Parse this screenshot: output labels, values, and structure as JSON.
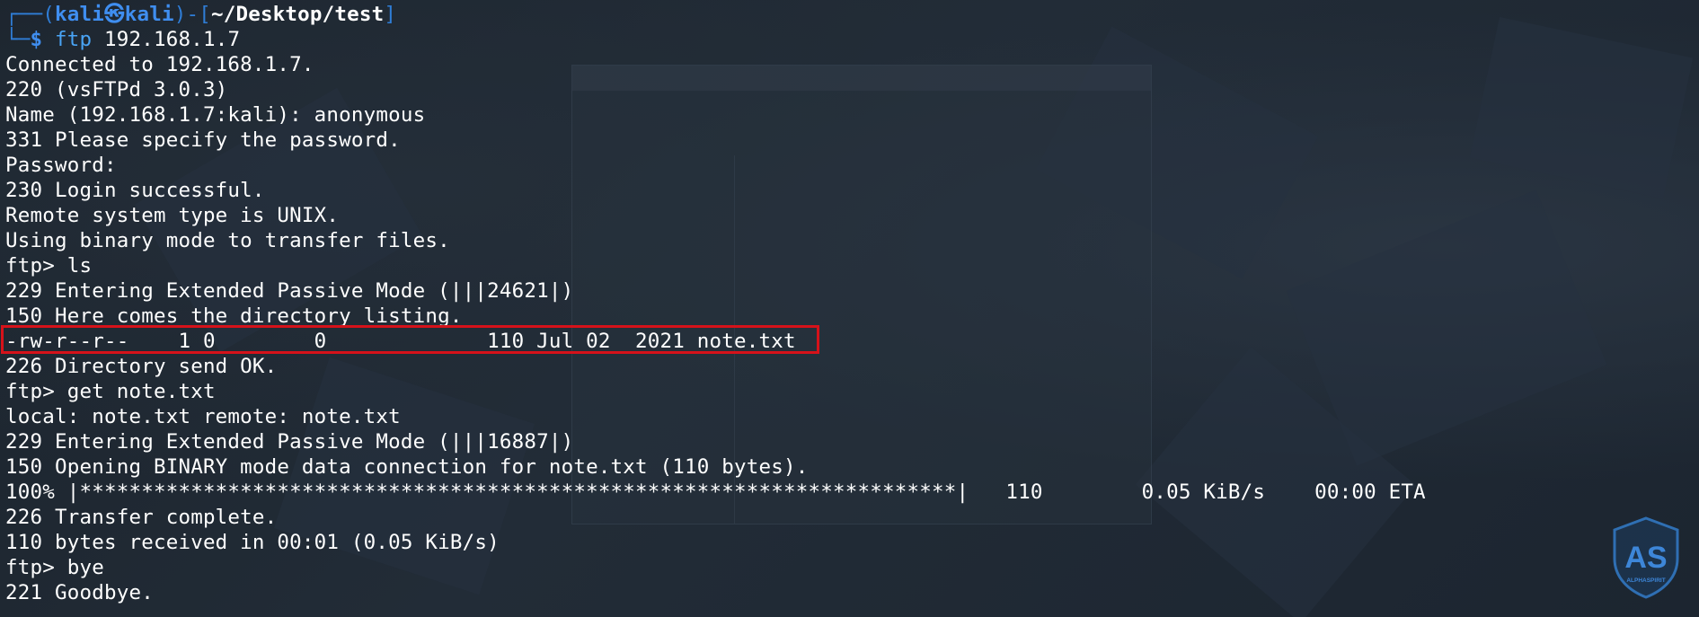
{
  "prompt": {
    "open": "┌──(",
    "user": "kali",
    "at_symbol": "㉿",
    "host": "kali",
    "mid": ")-[",
    "path": "~/Desktop/test",
    "close": "]",
    "corner": "└─",
    "dollar": "$",
    "command": "ftp",
    "args": " 192.168.1.7"
  },
  "output_lines": [
    "Connected to 192.168.1.7.",
    "220 (vsFTPd 3.0.3)",
    "Name (192.168.1.7:kali): anonymous",
    "331 Please specify the password.",
    "Password:",
    "230 Login successful.",
    "Remote system type is UNIX.",
    "Using binary mode to transfer files.",
    "ftp> ls",
    "229 Entering Extended Passive Mode (|||24621|)",
    "150 Here comes the directory listing.",
    "-rw-r--r--    1 0        0             110 Jul 02  2021 note.txt",
    "226 Directory send OK.",
    "ftp> get note.txt",
    "local: note.txt remote: note.txt",
    "229 Entering Extended Passive Mode (|||16887|)",
    "150 Opening BINARY mode data connection for note.txt (110 bytes).",
    "100% |***********************************************************************|   110        0.05 KiB/s    00:00 ETA",
    "226 Transfer complete.",
    "110 bytes received in 00:01 (0.05 KiB/s)",
    "ftp> bye",
    "221 Goodbye."
  ],
  "highlighted_line_index": 11,
  "watermark": {
    "letters": "AS",
    "caption": "ALPHASPIRIT"
  },
  "colors": {
    "background": "#1d2630",
    "prompt_blue": "#3f8ef0",
    "command_blue": "#49a4f5",
    "text": "#ffffff",
    "highlight_red": "#d6121a"
  }
}
